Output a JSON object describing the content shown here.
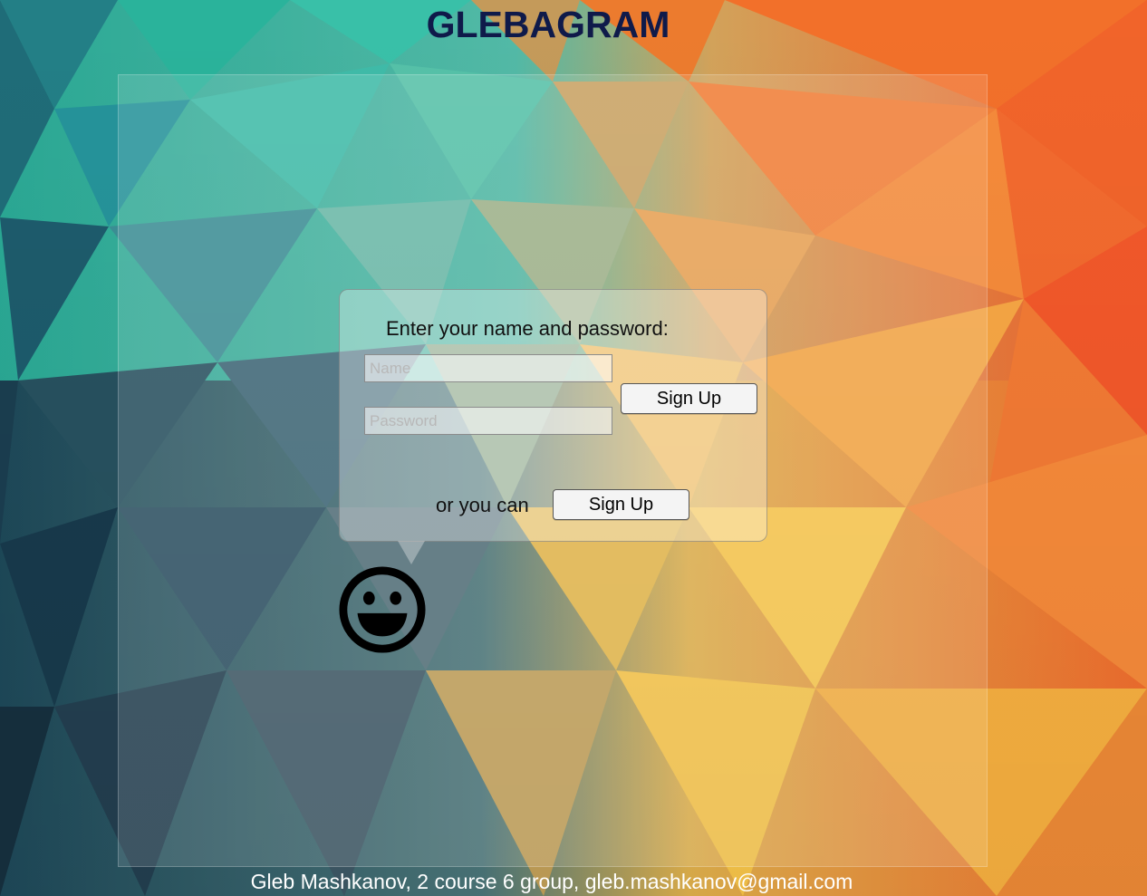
{
  "app": {
    "title": "GLEBAGRAM"
  },
  "login": {
    "prompt": "Enter your name and password:",
    "name_placeholder": "Name",
    "password_placeholder": "Password",
    "signin_label": "Sign Up",
    "alt_text": "or you can",
    "signup_label": "Sign Up"
  },
  "mascot": {
    "icon": "smiley-face-icon"
  },
  "footer": {
    "text": "Gleb Mashkanov, 2 course 6 group, gleb.mashkanov@gmail.com"
  },
  "colors": {
    "title": "#0f1a4a",
    "footer_text": "#ffffff",
    "background_left": "#1e5a6a",
    "background_right": "#f06a28"
  }
}
